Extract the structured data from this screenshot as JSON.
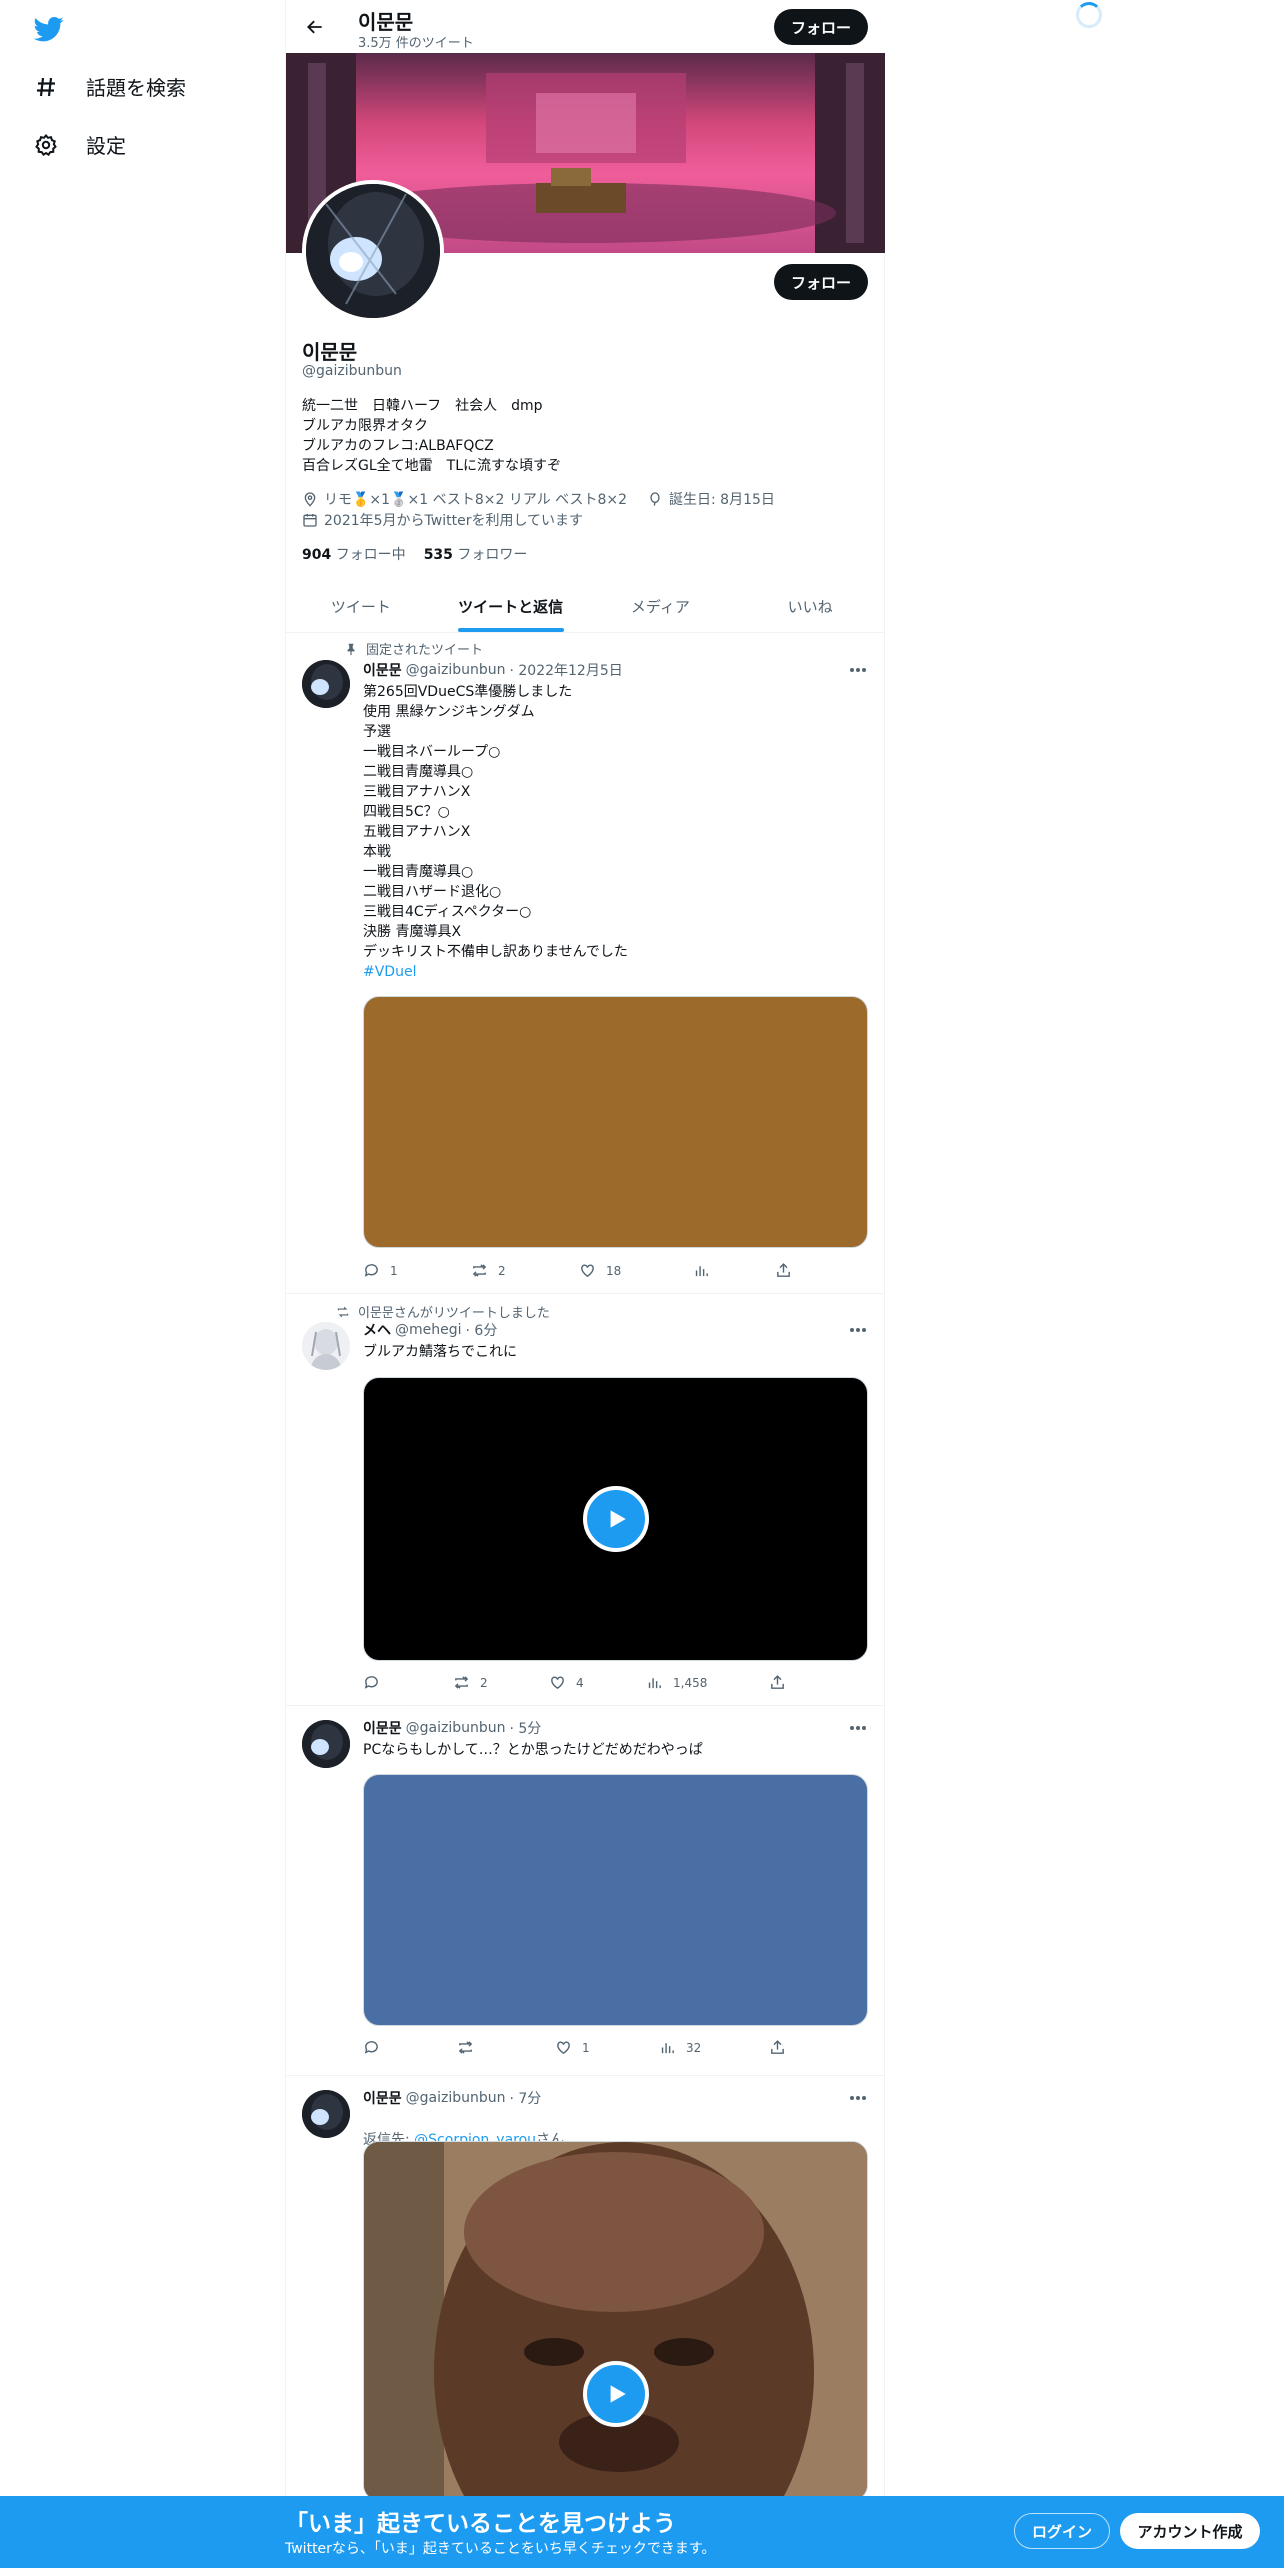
{
  "nav": {
    "explore_label": "話題を検索",
    "settings_label": "設定"
  },
  "header": {
    "name": "이문문",
    "tweet_count": "3.5万 件のツイート",
    "follow_label": "フォロー"
  },
  "profile": {
    "name": "이문문",
    "handle": "@gaizibunbun",
    "bio": "統一二世　日韓ハーフ　社会人　dmp\nブルアカ限界オタク\nブルアカのフレコ:ALBAFQCZ\n百合レズGL全て地雷　TLに流すな頃すぞ",
    "location": "リモ🥇×1🥈×1 ベスト8×2 リアル ベスト8×2",
    "birthday": "誕生日: 8月15日",
    "joined": "2021年5月からTwitterを利用しています",
    "following_count": "904",
    "following_label": "フォロー中",
    "followers_count": "535",
    "followers_label": "フォロワー",
    "follow_label": "フォロー"
  },
  "tabs": [
    "ツイート",
    "ツイートと返信",
    "メディア",
    "いいね"
  ],
  "tweets": [
    {
      "context": "固定されたツイート",
      "name": "이문문",
      "handle": "@gaizibunbun",
      "date": "· 2022年12月5日",
      "body": "第265回VDueCS準優勝しました\n使用 黒緑ケンジキングダム\n予選\n一戦目ネバーループ○\n二戦目青魔導具○\n三戦目アナハンX\n四戦目5C？○\n五戦目アナハンX\n本戦\n一戦目青魔導具○\n二戦目ハザード退化○\n三戦目4Cディスペクター○\n決勝 青魔導具X\nデッキリスト不備申し訳ありませんでした",
      "hashtag": "#VDuel",
      "media_color": "#9c6a2a",
      "replies": "1",
      "retweets": "2",
      "likes": "18",
      "views": ""
    },
    {
      "context": "이문문さんがリツイートしました",
      "name": "メヘ",
      "handle": "@mehegi",
      "date": "· 6分",
      "body": "ブルアカ鯖落ちでこれに",
      "media_color": "#000000",
      "replies": "",
      "retweets": "2",
      "likes": "4",
      "views": "1,458"
    },
    {
      "name": "이문문",
      "handle": "@gaizibunbun",
      "date": "· 5分",
      "body": "PCならもしかして…？とか思ったけどだめだわやっぱ",
      "media_color": "#4a6fa5",
      "replies": "",
      "retweets": "",
      "likes": "1",
      "views": "32"
    },
    {
      "name": "이문문",
      "handle": "@gaizibunbun",
      "date": "· 7分",
      "reply_prefix": "返信先: ",
      "reply_to": "@Scorpion_yarou",
      "reply_suffix": "さん"
    }
  ],
  "bottom_bar": {
    "title": "「いま」起きていることを見つけよう",
    "subtitle": "Twitterなら、「いま」起きていることをいち早くチェックできます。",
    "login_label": "ログイン",
    "signup_label": "アカウント作成"
  },
  "colors": {
    "accent": "#1d9bf0",
    "text": "#0f1419",
    "muted": "#536471"
  }
}
